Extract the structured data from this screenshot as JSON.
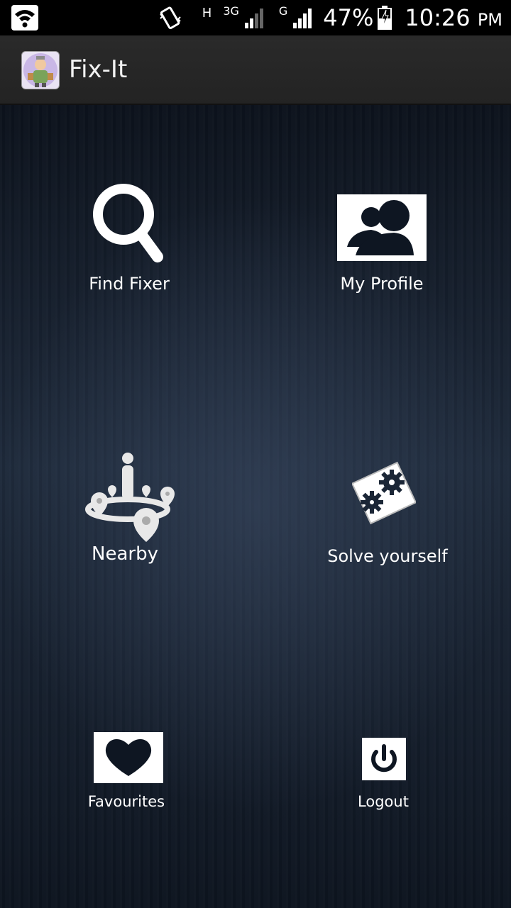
{
  "status_bar": {
    "network_h": "H",
    "network_3g": "3G",
    "network_g": "G",
    "battery_percent": "47%",
    "time": "10:26",
    "ampm": "PM"
  },
  "action_bar": {
    "title": "Fix-It"
  },
  "menu": {
    "find_fixer": "Find Fixer",
    "my_profile": "My Profile",
    "nearby": "Nearby",
    "solve_yourself": "Solve yourself",
    "favourites": "Favourites",
    "logout": "Logout"
  },
  "icons": {
    "find_fixer": "search-icon",
    "my_profile": "users-icon",
    "nearby": "location-pins-icon",
    "solve_yourself": "gears-icon",
    "favourites": "heart-icon",
    "logout": "power-icon"
  }
}
